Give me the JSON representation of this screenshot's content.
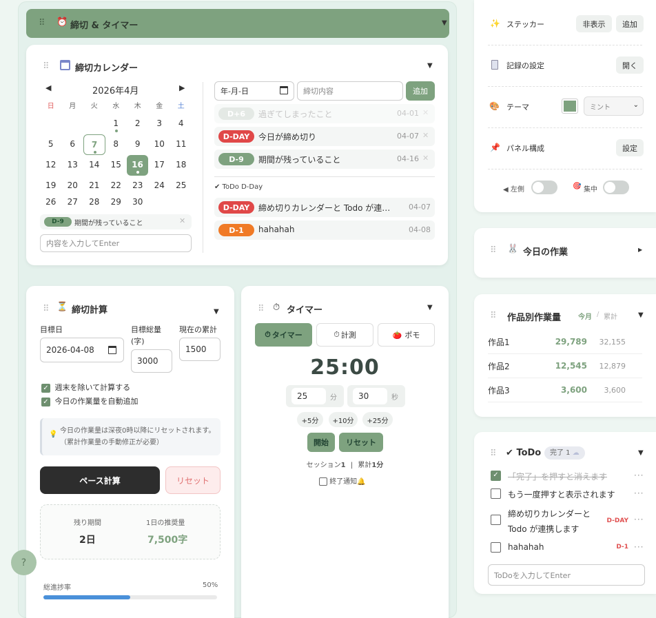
{
  "deadline_timer_bar": {
    "title": "締切 & タイマー",
    "icon": "alarm-clock-icon",
    "caret": "▼"
  },
  "calendar": {
    "title": "締切カレンダー",
    "month": "2026年4月",
    "prev": "◀",
    "next": "▶",
    "weekdays": [
      "日",
      "月",
      "火",
      "水",
      "木",
      "金",
      "土"
    ],
    "weeks": [
      [
        "",
        "",
        "",
        "1",
        "2",
        "3",
        "4"
      ],
      [
        "5",
        "6",
        "7",
        "8",
        "9",
        "10",
        "11"
      ],
      [
        "12",
        "13",
        "14",
        "15",
        "16",
        "17",
        "18"
      ],
      [
        "19",
        "20",
        "21",
        "22",
        "23",
        "24",
        "25"
      ],
      [
        "26",
        "27",
        "28",
        "29",
        "30",
        "",
        ""
      ]
    ],
    "selected_badge": "D-9",
    "selected_text": "期間が残っていること",
    "input_placeholder": "内容を入力してEnter",
    "date_placeholder": "年-月-日",
    "content_placeholder": "締切内容",
    "add_label": "追加",
    "deadlines": [
      {
        "badge": "D+6",
        "text": "過ぎてしまったこと",
        "date": "04-01",
        "color": "#cfd8d0"
      },
      {
        "badge": "D-DAY",
        "text": "今日が締め切り",
        "date": "04-07",
        "color": "#e04848"
      },
      {
        "badge": "D-9",
        "text": "期間が残っていること",
        "date": "04-16",
        "color": "#7ea27f"
      }
    ],
    "todo_dday_title": "✔ ToDo D-Day",
    "todo_ddays": [
      {
        "badge": "D-DAY",
        "text": "締め切りカレンダーと Todo が連…",
        "date": "04-07",
        "color": "#e04848"
      },
      {
        "badge": "D-1",
        "text": "hahahah",
        "date": "04-08",
        "color": "#f07a26"
      }
    ]
  },
  "deadline_calc": {
    "title": "締切計算",
    "target_date_label": "目標日",
    "target_total_label": "目標総量",
    "target_total_unit": "(字)",
    "current_total_label": "現在の累計",
    "target_date_value": "2026-04-08",
    "target_total_value": "3000",
    "current_total_value": "1500",
    "exclude_weekend": "週末を除いて計算する",
    "auto_add": "今日の作業量を自動追加",
    "info_text": "今日の作業量は深夜0時以降にリセットされます。（累計作業量の手動修正が必要）",
    "pace_button": "ペース計算",
    "reset_button": "リセット",
    "remaining_label": "残り期間",
    "remaining_value": "2日",
    "daily_label": "1日の推奨量",
    "daily_value": "7,500字",
    "progress_label": "総進捗率",
    "progress_text": "50%",
    "progress_fraction": 0.5
  },
  "timer": {
    "title": "タイマー",
    "tabs": [
      "タイマー",
      "計測",
      "ポモ"
    ],
    "display": "25:00",
    "minutes": "25",
    "min_unit": "分",
    "seconds": "30",
    "sec_unit": "秒",
    "quick": [
      "+5分",
      "+10分",
      "+25分"
    ],
    "start": "開始",
    "reset": "リセット",
    "session_label": "セッション",
    "session_value": "1",
    "total_label": "累計",
    "total_value": "1分",
    "notify": "終了通知🔔"
  },
  "settings": {
    "sticker_label": "ステッカー",
    "sticker_hide": "非表示",
    "sticker_add": "追加",
    "record_label": "記録の設定",
    "record_open": "開く",
    "theme_label": "テーマ",
    "theme_value": "ミント",
    "theme_color": "#7ea27f",
    "panel_label": "パネル構成",
    "panel_set": "設定",
    "left_label": "◀ 左側",
    "focus_label": "集中"
  },
  "today_work": {
    "title": "今日の作業",
    "caret": "▶"
  },
  "works": {
    "title": "作品別作業量",
    "today": "今月",
    "sep": "/",
    "total": "累計",
    "items": [
      {
        "name": "作品1",
        "today": "29,789",
        "total": "32,155"
      },
      {
        "name": "作品2",
        "today": "12,545",
        "total": "12,879"
      },
      {
        "name": "作品3",
        "today": "3,600",
        "total": "3,600"
      }
    ]
  },
  "todo": {
    "title": "ToDo",
    "done_badge": "完了 1",
    "items": [
      {
        "text": "「完了」を押すと消えます",
        "done": true,
        "tag": ""
      },
      {
        "text": "もう一度押すと表示されます",
        "done": false,
        "tag": ""
      },
      {
        "text": "締め切りカレンダーと",
        "text2": "Todo が連携します",
        "done": false,
        "tag": "D-DAY"
      },
      {
        "text": "hahahah",
        "done": false,
        "tag": "D-1"
      }
    ],
    "input_placeholder": "ToDoを入力してEnter"
  },
  "help": "?"
}
